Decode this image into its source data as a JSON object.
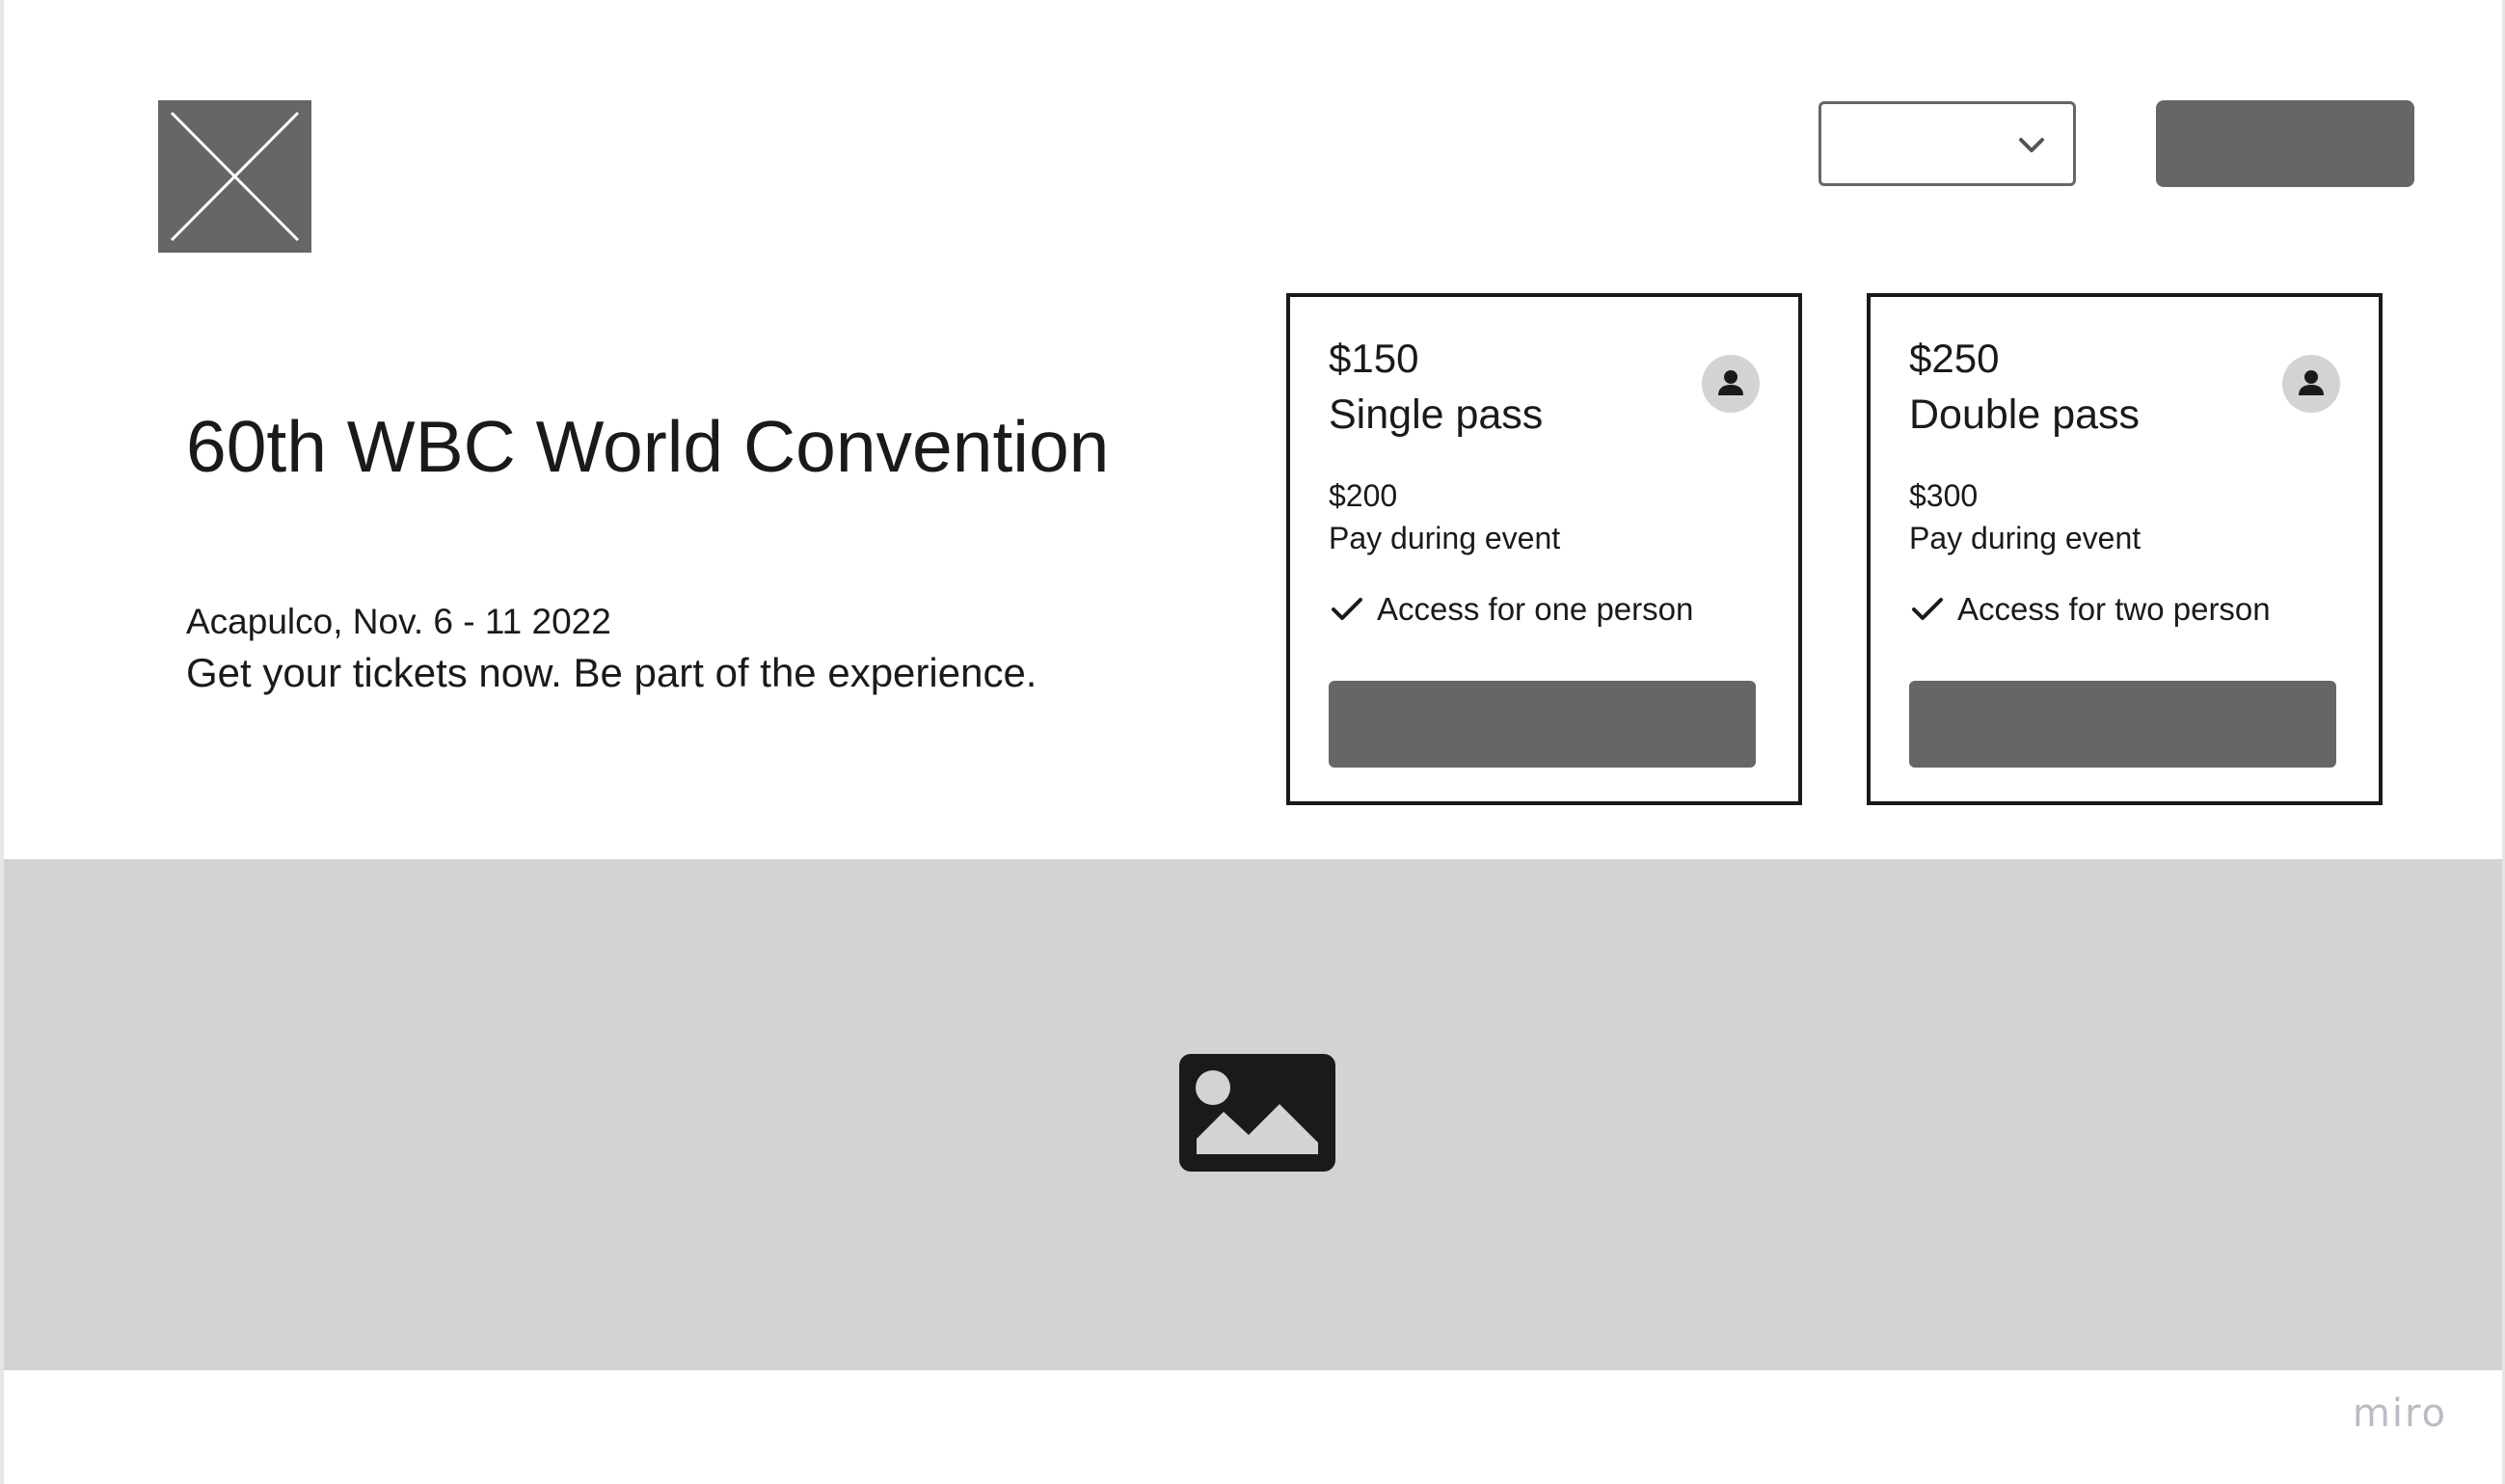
{
  "header": {
    "logo_icon": "image-placeholder-icon",
    "dropdown": {
      "selected": "",
      "icon": "chevron-down-icon"
    },
    "action_button_label": ""
  },
  "hero": {
    "title": "60th WBC World Convention",
    "subtitle": "Acapulco, Nov. 6 - 11 2022",
    "tagline": "Get your tickets now. Be part of the experience."
  },
  "tickets": [
    {
      "price": "$150",
      "name": "Single pass",
      "alt_price": "$200",
      "alt_note": "Pay during event",
      "feature": "Access for one person",
      "button_label": "",
      "icon": "user-icon"
    },
    {
      "price": "$250",
      "name": "Double pass",
      "alt_price": "$300",
      "alt_note": "Pay during event",
      "feature": "Access for two person",
      "button_label": "",
      "icon": "user-icon"
    }
  ],
  "banner": {
    "icon": "image-icon"
  },
  "watermark": "miro",
  "colors": {
    "placeholder_dark": "#666666",
    "placeholder_light": "#d3d3d3",
    "text": "#1a1a1a",
    "watermark": "#b9bcc4"
  }
}
